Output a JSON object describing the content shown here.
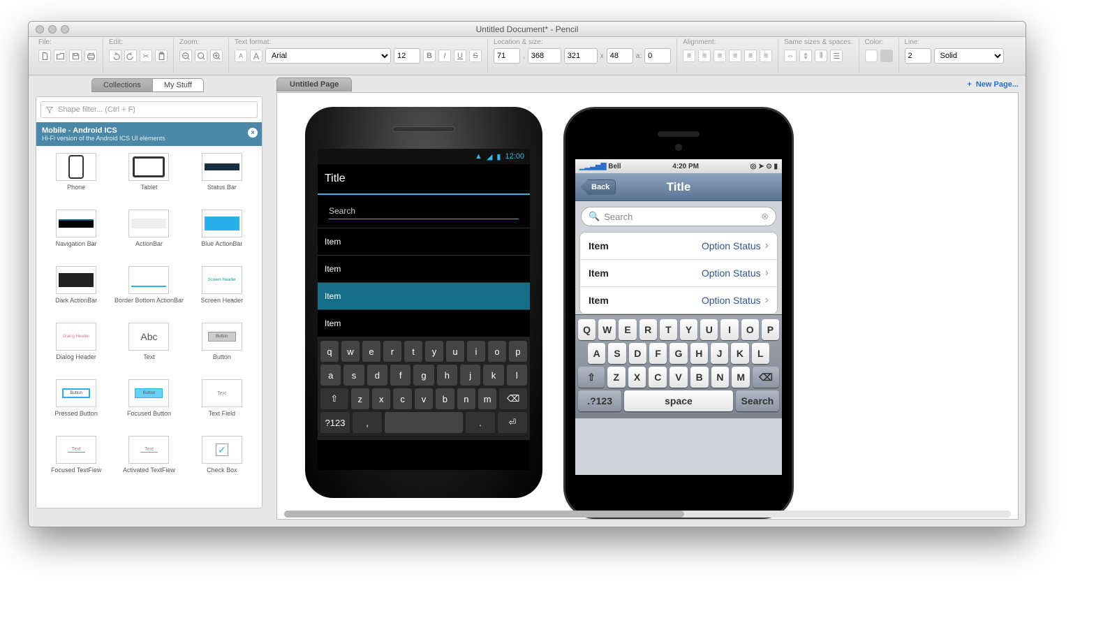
{
  "window": {
    "title": "Untitled Document* - Pencil"
  },
  "toolbar": {
    "file": {
      "label": "File:"
    },
    "edit": {
      "label": "Edit:"
    },
    "zoom": {
      "label": "Zoom:"
    },
    "textformat": {
      "label": "Text format:",
      "font": "Arial",
      "size": "12"
    },
    "location": {
      "label": "Location & size:",
      "x": "71",
      "y": "368",
      "w": "321",
      "h": "48",
      "a": "0"
    },
    "alignment": {
      "label": "Alignment:"
    },
    "samesizes": {
      "label": "Same sizes & spaces:"
    },
    "color": {
      "label": "Color:"
    },
    "line": {
      "label": "Line:",
      "width": "2",
      "style": "Solid"
    }
  },
  "sidebar": {
    "tabs": {
      "collections": "Collections",
      "mystuff": "My Stuff"
    },
    "filter_placeholder": "Shape filter... (Ctrl + F)",
    "category": {
      "title": "Mobile - Android ICS",
      "subtitle": "Hi-Fi version of the Android ICS UI elements"
    },
    "shapes": [
      "Phone",
      "Tablet",
      "Status Bar",
      "Navigation Bar",
      "ActionBar",
      "Blue ActionBar",
      "Dark ActionBar",
      "Border Bottom ActionBar",
      "Screen Header",
      "Dialog Header",
      "Text",
      "Button",
      "Pressed Button",
      "Focused Button",
      "Text Field",
      "Focused TextFiew",
      "Activated TextFiew",
      "Check Box"
    ]
  },
  "pages": {
    "current": "Untitled Page",
    "new_label": "New Page..."
  },
  "android": {
    "time": "12:00",
    "title": "Title",
    "search": "Search",
    "items": [
      "Item",
      "Item",
      "Item",
      "Item"
    ],
    "keys_r1": [
      "q",
      "w",
      "e",
      "r",
      "t",
      "y",
      "u",
      "i",
      "o",
      "p"
    ],
    "keys_r2": [
      "a",
      "s",
      "d",
      "f",
      "g",
      "h",
      "j",
      "k",
      "l"
    ],
    "keys_r3": [
      "z",
      "x",
      "c",
      "v",
      "b",
      "n",
      "m"
    ]
  },
  "iphone": {
    "carrier": "Bell",
    "time": "4:20 PM",
    "title": "Title",
    "back": "Back",
    "search": "Search",
    "items": [
      {
        "l": "Item",
        "r": "Option Status"
      },
      {
        "l": "Item",
        "r": "Option Status"
      },
      {
        "l": "Item",
        "r": "Option Status"
      }
    ],
    "keys_r1": [
      "Q",
      "W",
      "E",
      "R",
      "T",
      "Y",
      "U",
      "I",
      "O",
      "P"
    ],
    "keys_r2": [
      "A",
      "S",
      "D",
      "F",
      "G",
      "H",
      "J",
      "K",
      "L"
    ],
    "keys_r3": [
      "Z",
      "X",
      "C",
      "V",
      "B",
      "N",
      "M"
    ],
    "numkey": ".?123",
    "space": "space",
    "action": "Search"
  }
}
